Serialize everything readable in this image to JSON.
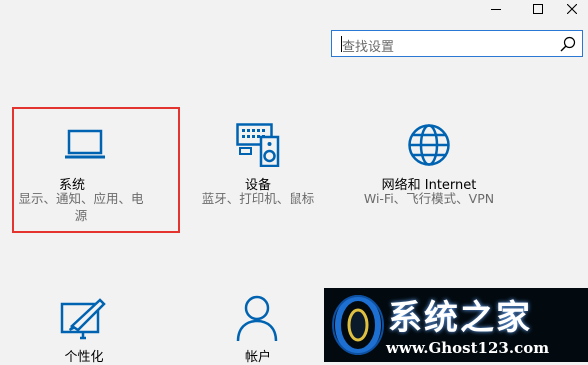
{
  "window": {
    "minimize_glyph": "—",
    "maximize_glyph": "☐",
    "close_glyph": "✕"
  },
  "search": {
    "placeholder": "查找设置"
  },
  "tiles": [
    {
      "title": "系统",
      "desc_line1": "显示、通知、应用、电",
      "desc_line2": "源",
      "icon": "laptop-icon"
    },
    {
      "title": "设备",
      "desc": "蓝牙、打印机、鼠标",
      "icon": "devices-icon"
    },
    {
      "title": "网络和 Internet",
      "desc": "Wi-Fi、飞行模式、VPN",
      "icon": "globe-icon"
    },
    {
      "title": "个性化",
      "icon": "personalization-icon"
    },
    {
      "title": "帐户",
      "icon": "account-icon"
    }
  ],
  "watermark": {
    "title": "系统之家",
    "url": "www.Ghost123.com"
  },
  "colors": {
    "accent": "#0063b1",
    "highlight": "#e3342f",
    "background": "#f2f2f2"
  }
}
